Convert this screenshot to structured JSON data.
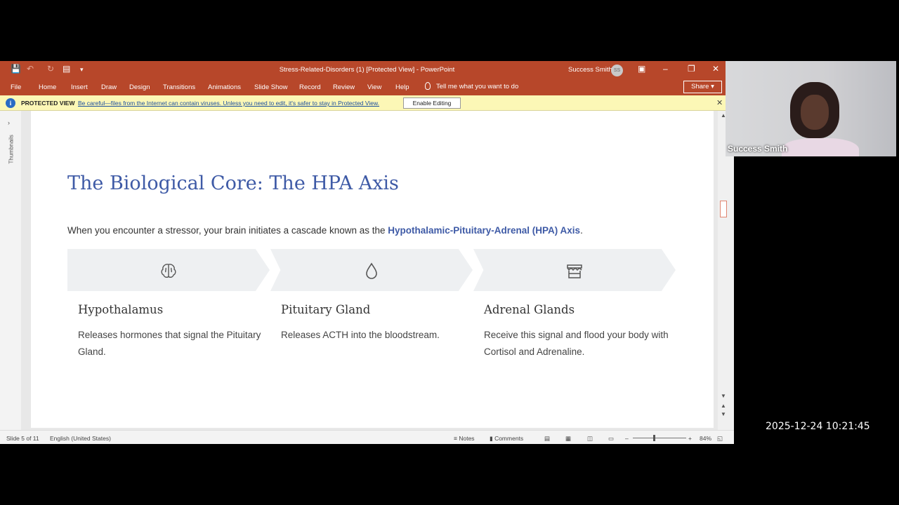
{
  "window": {
    "doc_title": "Stress-Related-Disorders (1) [Protected View]  -  PowerPoint",
    "user_name": "Success Smith",
    "user_initials": "SS",
    "share_label": "Share"
  },
  "ribbon": {
    "tabs": [
      "File",
      "Home",
      "Insert",
      "Draw",
      "Design",
      "Transitions",
      "Animations",
      "Slide Show",
      "Record",
      "Review",
      "View",
      "Help"
    ],
    "tell_me": "Tell me what you want to do"
  },
  "protected_view": {
    "label": "PROTECTED VIEW",
    "message": "Be careful—files from the Internet can contain viruses. Unless you need to edit, it's safer to stay in Protected View.",
    "enable_button": "Enable Editing"
  },
  "thumbnails": {
    "label": "Thumbnails"
  },
  "slide": {
    "title": "The Biological Core: The HPA Axis",
    "intro_prefix": "When you encounter a stressor, your brain initiates a cascade known as the ",
    "intro_highlight": "Hypothalamic-Pituitary-Adrenal (HPA) Axis",
    "intro_suffix": ".",
    "steps": [
      {
        "icon": "brain-icon",
        "title": "Hypothalamus",
        "desc": "Releases hormones that signal the Pituitary Gland."
      },
      {
        "icon": "droplet-icon",
        "title": "Pituitary Gland",
        "desc": "Releases ACTH into the bloodstream."
      },
      {
        "icon": "storefront-icon",
        "title": "Adrenal Glands",
        "desc": "Receive this signal and flood your body with Cortisol and Adrenaline."
      }
    ]
  },
  "statusbar": {
    "slide_info": "Slide 5 of 11",
    "language": "English (United States)",
    "notes": "Notes",
    "comments": "Comments",
    "zoom": "84%"
  },
  "webcam": {
    "name": "Success Smith"
  },
  "timestamp": "2025-12-24 10:21:45",
  "colors": {
    "accent": "#b7472a",
    "title_blue": "#3e5aa6"
  }
}
